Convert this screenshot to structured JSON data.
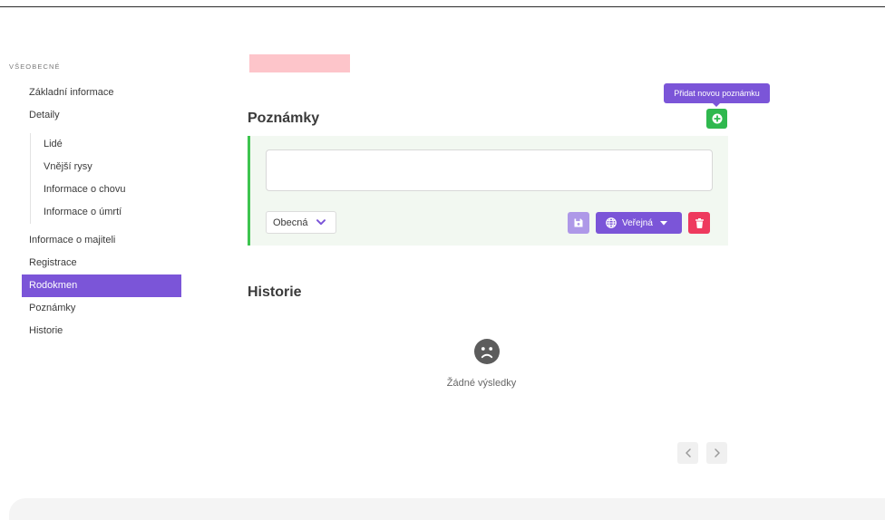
{
  "colors": {
    "accent": "#7b55d8",
    "accent_light": "#ae98e8",
    "success": "#2fb84e",
    "danger": "#ee3a5e",
    "note_bg": "#f2f8f1",
    "note_border": "#3ec44f",
    "redacted_block": "#fdc5ca"
  },
  "sidebar": {
    "section_label": "VŠEOBECNÉ",
    "items": [
      {
        "label": "Základní informace"
      },
      {
        "label": "Detaily"
      }
    ],
    "detail_items": [
      {
        "label": "Lidé"
      },
      {
        "label": "Vnější rysy"
      },
      {
        "label": "Informace o chovu"
      },
      {
        "label": "Informace o úmrtí"
      }
    ],
    "more_items": [
      {
        "label": "Informace o majiteli"
      },
      {
        "label": "Registrace"
      },
      {
        "label": "Rodokmen",
        "active": true
      },
      {
        "label": "Poznámky"
      },
      {
        "label": "Historie"
      }
    ]
  },
  "notes": {
    "heading": "Poznámky",
    "add_button": {
      "icon": "plus-circle-icon",
      "tooltip": "Přidat novou poznámku"
    },
    "editor": {
      "category": "Obecná",
      "category_icon": "chevron-down-icon",
      "save_icon": "floppy-disk-icon",
      "visibility": "Veřejná",
      "visibility_icon": "globe-icon",
      "visibility_caret_icon": "caret-down-icon",
      "delete_icon": "trash-icon"
    }
  },
  "history": {
    "heading": "Historie",
    "empty_icon": "sad-face-icon",
    "empty_text": "Žádné výsledky",
    "pagination": {
      "prev_icon": "chevron-left-icon",
      "next_icon": "chevron-right-icon"
    }
  }
}
